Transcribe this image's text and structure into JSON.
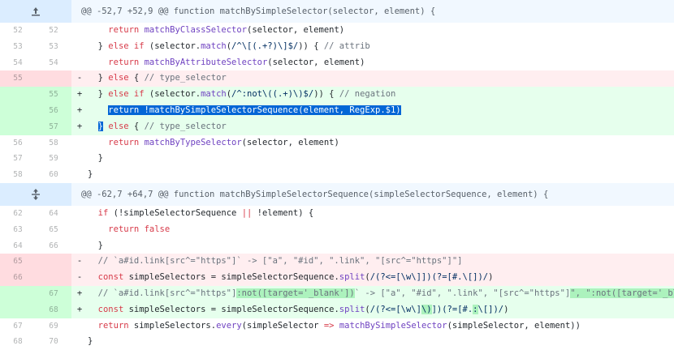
{
  "hunks": [
    {
      "header": "@@ -52,7 +52,9 @@ function matchBySimpleSelector(selector, element) {",
      "expand_icon": "expand-up-icon"
    },
    {
      "header": "@@ -62,7 +64,7 @@ function matchBySimpleSelectorSequence(simpleSelectorSequence, element) {",
      "expand_icon": "expand-both-icon"
    }
  ],
  "lines": [
    {
      "old": "52",
      "new": "52",
      "sign": "",
      "text": "    return matchByClassSelector(selector, element)"
    },
    {
      "old": "53",
      "new": "53",
      "sign": "",
      "text": "  } else if (selector.match(/^\\[(.+?)\\]$/)) { // attrib"
    },
    {
      "old": "54",
      "new": "54",
      "sign": "",
      "text": "    return matchByAttributeSelector(selector, element)"
    },
    {
      "old": "55",
      "new": "",
      "sign": "-",
      "text": "  } else { // type_selector"
    },
    {
      "old": "",
      "new": "55",
      "sign": "+",
      "text": "  } else if (selector.match(/^:not\\((.+)\\)$/)) { // negation"
    },
    {
      "old": "",
      "new": "56",
      "sign": "+",
      "text": "    return !matchBySimpleSelectorSequence(element, RegExp.$1)"
    },
    {
      "old": "",
      "new": "57",
      "sign": "+",
      "text": "  } else { // type_selector"
    },
    {
      "old": "56",
      "new": "58",
      "sign": "",
      "text": "    return matchByTypeSelector(selector, element)"
    },
    {
      "old": "57",
      "new": "59",
      "sign": "",
      "text": "  }"
    },
    {
      "old": "58",
      "new": "60",
      "sign": "",
      "text": "}"
    },
    {
      "old": "62",
      "new": "64",
      "sign": "",
      "text": "  if (!simpleSelectorSequence || !element) {"
    },
    {
      "old": "63",
      "new": "65",
      "sign": "",
      "text": "    return false"
    },
    {
      "old": "64",
      "new": "66",
      "sign": "",
      "text": "  }"
    },
    {
      "old": "65",
      "new": "",
      "sign": "-",
      "text": "  // `a#id.link[src^=\"https\"]` -> [\"a\", \"#id\", \".link\", \"[src^=\"https\"]\"]"
    },
    {
      "old": "66",
      "new": "",
      "sign": "-",
      "text": "  const simpleSelectors = simpleSelectorSequence.split(/(?<=[\\w\\]])(?=[#.\\[])/)"
    },
    {
      "old": "",
      "new": "67",
      "sign": "+",
      "text": "  // `a#id.link[src^=\"https\"]:not([target='_blank'])` -> [\"a\", \"#id\", \".link\", \"[src^=\"https\"]\", \":not([target='_blank'])\"]"
    },
    {
      "old": "",
      "new": "68",
      "sign": "+",
      "text": "  const simpleSelectors = simpleSelectorSequence.split(/(?<=[\\w\\]\\)])(?=[#.:\\[])/)"
    },
    {
      "old": "67",
      "new": "69",
      "sign": "",
      "text": "  return simpleSelectors.every(simpleSelector => matchBySimpleSelector(simpleSelector, element))"
    },
    {
      "old": "68",
      "new": "70",
      "sign": "",
      "text": "}"
    }
  ]
}
